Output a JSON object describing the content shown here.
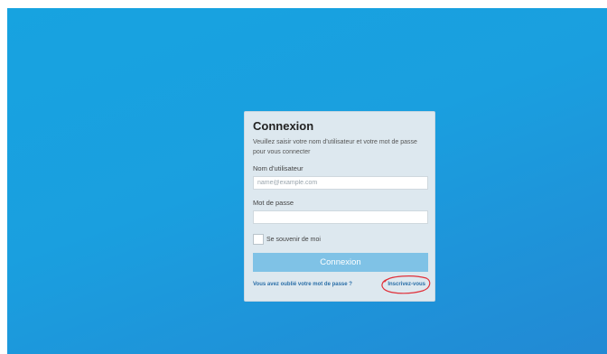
{
  "login": {
    "title": "Connexion",
    "description": "Veuillez saisir votre nom d'utilisateur et votre mot de passe pour vous connecter",
    "username_label": "Nom d'utilisateur",
    "username_placeholder": "name@example.com",
    "username_value": "",
    "password_label": "Mot de passe",
    "password_value": "",
    "remember_label": "Se souvenir de moi",
    "remember_checked": false,
    "submit_label": "Connexion",
    "forgot_link": "Vous avez oublié votre mot de passe ?",
    "signup_link": "Inscrivez-vous"
  },
  "colors": {
    "background": "#1a9fdf",
    "card": "#dde8ef",
    "button": "#7fc2e6",
    "link": "#2b6fa8",
    "annotation": "#e0303a"
  }
}
